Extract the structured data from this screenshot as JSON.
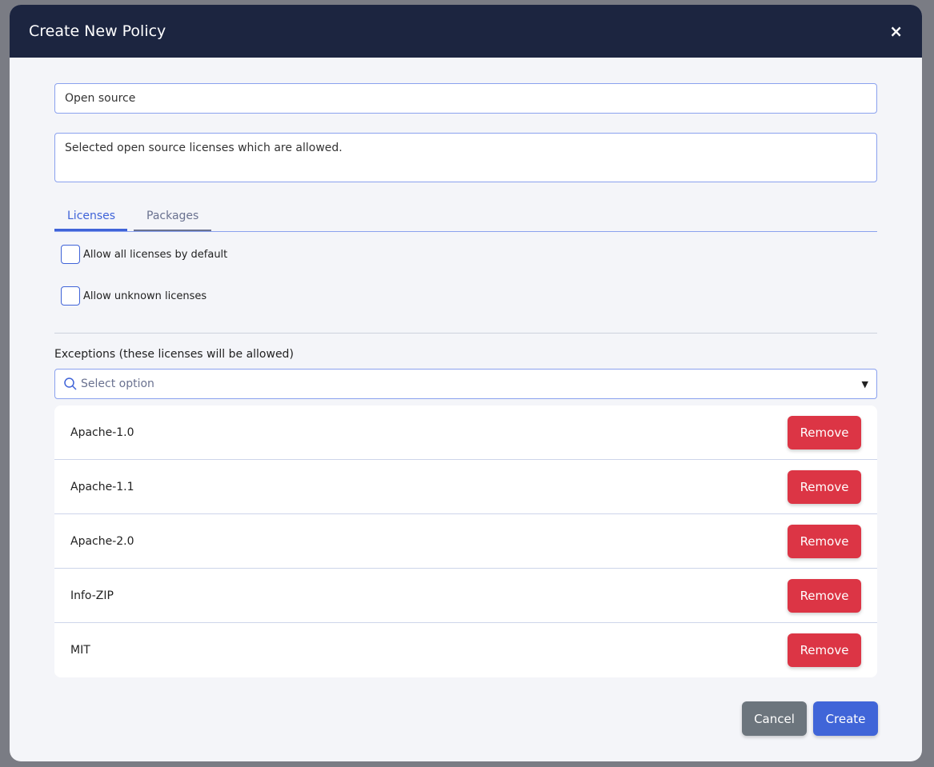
{
  "modal": {
    "title": "Create New Policy",
    "close_icon": "×"
  },
  "form": {
    "name": "Open source",
    "description": "Selected open source licenses which are allowed."
  },
  "tabs": [
    {
      "label": "Licenses",
      "active": true
    },
    {
      "label": "Packages",
      "active": false
    }
  ],
  "options": {
    "allow_all": "Allow all licenses by default",
    "allow_unknown": "Allow unknown licenses"
  },
  "exceptions": {
    "label": "Exceptions (these licenses will be allowed)",
    "placeholder": "Select option",
    "items": [
      {
        "name": "Apache-1.0"
      },
      {
        "name": "Apache-1.1"
      },
      {
        "name": "Apache-2.0"
      },
      {
        "name": "Info-ZIP"
      },
      {
        "name": "MIT"
      }
    ],
    "remove_label": "Remove"
  },
  "footer": {
    "cancel": "Cancel",
    "create": "Create"
  },
  "colors": {
    "header": "#1c2540",
    "accent": "#4065d8",
    "danger": "#dc3545",
    "secondary": "#6c757d"
  }
}
